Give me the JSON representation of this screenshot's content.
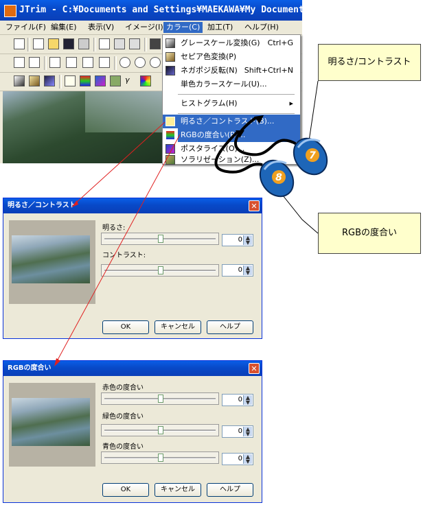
{
  "main_window": {
    "title": "JTrim - C:¥Documents and Settings¥MAEKAWA¥My Documents",
    "menu": [
      {
        "label": "ファイル(F)",
        "active": false
      },
      {
        "label": "編集(E)",
        "active": false
      },
      {
        "label": "表示(V)",
        "active": false
      },
      {
        "label": "イメージ(I)",
        "active": false
      },
      {
        "label": "カラー(C)",
        "active": true
      },
      {
        "label": "加工(T)",
        "active": false
      },
      {
        "label": "ヘルプ(H)",
        "active": false
      }
    ]
  },
  "color_menu": {
    "items": [
      {
        "label": "グレースケール変換(G)",
        "shortcut": "Ctrl+G",
        "icon": "grayscale-icon",
        "highlight": false
      },
      {
        "label": "セピア色変換(P)",
        "shortcut": "",
        "icon": "sepia-icon",
        "highlight": false
      },
      {
        "label": "ネガポジ反転(N)",
        "shortcut": "Shift+Ctrl+N",
        "icon": "negative-icon",
        "highlight": false
      },
      {
        "label": "単色カラースケール(U)...",
        "shortcut": "",
        "icon": "",
        "highlight": false
      },
      {
        "label": "ヒストグラム(H)",
        "shortcut": "▸",
        "icon": "",
        "highlight": false
      },
      {
        "label": "明るさ／コントラスト(B)...",
        "shortcut": "",
        "icon": "brightness-icon",
        "highlight": true
      },
      {
        "label": "RGBの度合い(R)...",
        "shortcut": "",
        "icon": "rgb-icon",
        "highlight": true
      },
      {
        "label": "ポスタライズ(O)...",
        "shortcut": "",
        "icon": "posterize-icon",
        "highlight": false
      },
      {
        "label": "ソラリゼーション(Z)...",
        "shortcut": "",
        "icon": "solarize-icon",
        "highlight": false
      }
    ]
  },
  "callouts": {
    "brightness": "明るさ/コントラスト",
    "rgb": "RGBの度合い"
  },
  "mouse_badges": {
    "first": "7",
    "second": "8"
  },
  "brightness_dialog": {
    "title": "明るさ／コントラスト",
    "brightness_label": "明るさ:",
    "brightness_value": "0",
    "contrast_label": "コントラスト:",
    "contrast_value": "0",
    "ok": "OK",
    "cancel": "キャンセル",
    "help": "ヘルプ"
  },
  "rgb_dialog": {
    "title": "RGBの度合い",
    "red_label": "赤色の度合い",
    "red_value": "0",
    "green_label": "緑色の度合い",
    "green_value": "0",
    "blue_label": "青色の度合い",
    "blue_value": "0",
    "ok": "OK",
    "cancel": "キャンセル",
    "help": "ヘルプ"
  },
  "colors": {
    "titlebar": "#0849c8",
    "menu_highlight": "#316ac5",
    "callout_bg": "#ffffcc",
    "mouse_body": "#1e66b8",
    "mouse_badge": "#f0a020",
    "arrow": "#e02020"
  }
}
